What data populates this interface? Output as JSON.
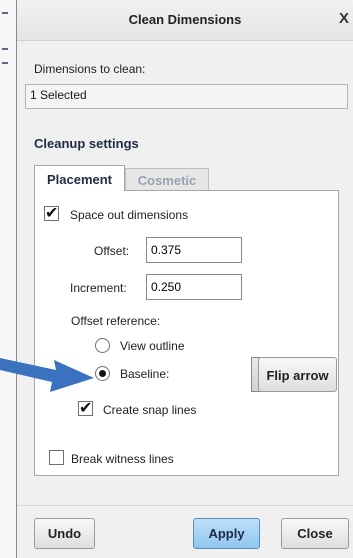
{
  "window": {
    "title": "Clean Dimensions",
    "close_glyph": "X"
  },
  "dimensions": {
    "label": "Dimensions to clean:",
    "value": "1 Selected"
  },
  "cleanup": {
    "title": "Cleanup settings",
    "tabs": [
      {
        "label": "Placement",
        "active": true
      },
      {
        "label": "Cosmetic",
        "active": false
      }
    ]
  },
  "placement": {
    "space_out": {
      "label": "Space out dimensions",
      "checked": true
    },
    "offset": {
      "label": "Offset:",
      "value": "0.375"
    },
    "increment": {
      "label": "Increment:",
      "value": "0.250"
    },
    "offset_reference": {
      "label": "Offset reference:",
      "options": [
        {
          "label": "View outline",
          "selected": false
        },
        {
          "label": "Baseline:",
          "selected": true
        }
      ]
    },
    "pick_icon": "cursor-arrow-icon",
    "flip_arrow_label": "Flip arrow",
    "snap_lines": {
      "label": "Create snap lines",
      "checked": true
    },
    "break_witness": {
      "label": "Break witness lines",
      "checked": false
    }
  },
  "footer": {
    "undo": "Undo",
    "apply": "Apply",
    "close": "Close"
  },
  "colors": {
    "annotation_arrow": "#3a72c0",
    "apply_button": "#8ec6ef",
    "section_title": "#1f2a44"
  }
}
